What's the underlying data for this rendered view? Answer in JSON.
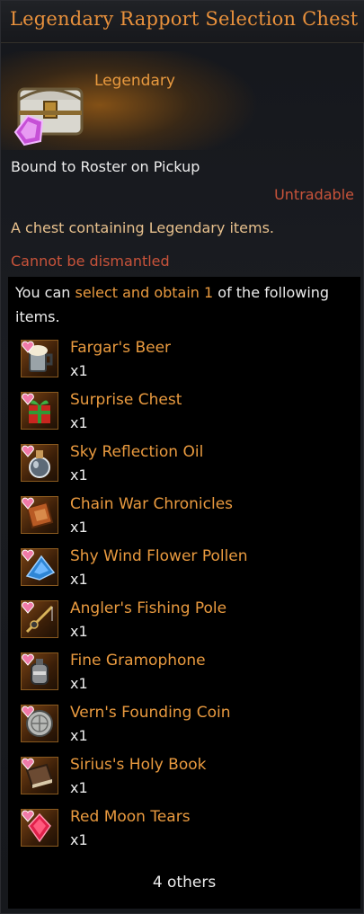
{
  "title": "Legendary Rapport Selection Chest",
  "grade": "Legendary",
  "bound_text": "Bound to Roster on Pickup",
  "untradable_text": "Untradable",
  "description": "A chest containing Legendary items.",
  "dismantle_text": "Cannot be dismantled",
  "selection": {
    "prefix": "You can ",
    "highlight": "select and obtain 1",
    "suffix": " of the following items."
  },
  "items": [
    {
      "name": "Fargar's Beer",
      "qty": "x1",
      "icon": "beer-mug-icon"
    },
    {
      "name": "Surprise Chest",
      "qty": "x1",
      "icon": "gift-box-icon"
    },
    {
      "name": "Sky Reflection Oil",
      "qty": "x1",
      "icon": "potion-flask-icon"
    },
    {
      "name": "Chain War Chronicles",
      "qty": "x1",
      "icon": "book-icon"
    },
    {
      "name": "Shy Wind Flower Pollen",
      "qty": "x1",
      "icon": "pollen-pile-icon"
    },
    {
      "name": "Angler's Fishing Pole",
      "qty": "x1",
      "icon": "fishing-pole-icon"
    },
    {
      "name": "Fine Gramophone",
      "qty": "x1",
      "icon": "gramophone-icon"
    },
    {
      "name": "Vern's Founding Coin",
      "qty": "x1",
      "icon": "coin-icon"
    },
    {
      "name": "Sirius's Holy Book",
      "qty": "x1",
      "icon": "holy-book-icon"
    },
    {
      "name": "Red Moon Tears",
      "qty": "x1",
      "icon": "red-gem-icon"
    }
  ],
  "others_text": "4 others",
  "colors": {
    "accent": "#e99a3f",
    "warning": "#c8533a",
    "text": "#ececec",
    "desc": "#e7c08d"
  }
}
